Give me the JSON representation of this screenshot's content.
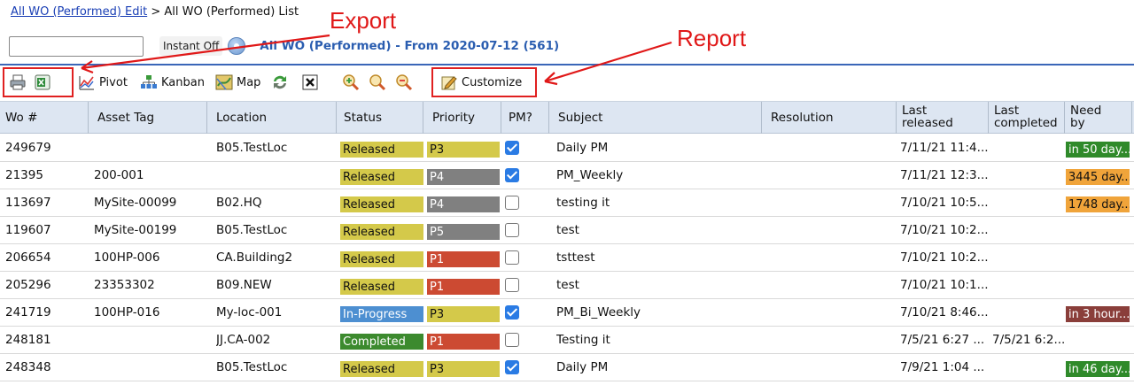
{
  "breadcrumb": {
    "link": "All WO (Performed) Edit",
    "separator": ">",
    "current": "All WO (Performed) List"
  },
  "search": {
    "value": "",
    "placeholder": ""
  },
  "instant_label": "Instant Off",
  "list_title": "All WO (Performed) - From 2020-07-12 (561)",
  "toolbar": {
    "pivot": "Pivot",
    "kanban": "Kanban",
    "map": "Map",
    "customize": "Customize"
  },
  "annotations": {
    "export": "Export",
    "report": "Report"
  },
  "colors": {
    "accent": "#3a66b8",
    "released": "#d4c94a",
    "in_progress": "#4d8fd1",
    "completed": "#3c8a2e",
    "p1": "#cc4a32",
    "p3": "#d4c94a",
    "p4": "#808080",
    "p5": "#808080",
    "need_green": "#2f8a2a",
    "need_orange": "#f0a43a",
    "need_brown": "#8a3e3a",
    "annotation": "#e01818"
  },
  "columns": {
    "wo": "Wo #",
    "asset": "Asset Tag",
    "location": "Location",
    "status": "Status",
    "priority": "Priority",
    "pm": "PM?",
    "subject": "Subject",
    "resolution": "Resolution",
    "last_released_1": "Last",
    "last_released_2": "released",
    "last_completed_1": "Last",
    "last_completed_2": "completed",
    "need_by_1": "Need",
    "need_by_2": "by"
  },
  "rows": [
    {
      "wo": "249679",
      "asset": "",
      "location": "B05.TestLoc",
      "status": "Released",
      "priority": "P3",
      "pm": true,
      "subject": "Daily PM",
      "resolution": "",
      "last_released": "7/11/21 11:4...",
      "last_completed": "",
      "need_by": "in 50 day...",
      "need_color": "green"
    },
    {
      "wo": "21395",
      "asset": "200-001",
      "location": "",
      "status": "Released",
      "priority": "P4",
      "pm": true,
      "subject": "PM_Weekly",
      "resolution": "",
      "last_released": "7/11/21 12:3...",
      "last_completed": "",
      "need_by": "3445 day...",
      "need_color": "orange"
    },
    {
      "wo": "113697",
      "asset": "MySite-00099",
      "location": "B02.HQ",
      "status": "Released",
      "priority": "P4",
      "pm": false,
      "subject": "testing it",
      "resolution": "",
      "last_released": "7/10/21 10:5...",
      "last_completed": "",
      "need_by": "1748 day...",
      "need_color": "orange"
    },
    {
      "wo": "119607",
      "asset": "MySite-00199",
      "location": "B05.TestLoc",
      "status": "Released",
      "priority": "P5",
      "pm": false,
      "subject": "test",
      "resolution": "",
      "last_released": "7/10/21 10:2...",
      "last_completed": "",
      "need_by": "",
      "need_color": ""
    },
    {
      "wo": "206654",
      "asset": "100HP-006",
      "location": "CA.Building2",
      "status": "Released",
      "priority": "P1",
      "pm": false,
      "subject": "tsttest",
      "resolution": "",
      "last_released": "7/10/21 10:2...",
      "last_completed": "",
      "need_by": "",
      "need_color": ""
    },
    {
      "wo": "205296",
      "asset": "23353302",
      "location": "B09.NEW",
      "status": "Released",
      "priority": "P1",
      "pm": false,
      "subject": "test",
      "resolution": "",
      "last_released": "7/10/21 10:1...",
      "last_completed": "",
      "need_by": "",
      "need_color": ""
    },
    {
      "wo": "241719",
      "asset": "100HP-016",
      "location": "My-loc-001",
      "status": "In-Progress",
      "priority": "P3",
      "pm": true,
      "subject": "PM_Bi_Weekly",
      "resolution": "",
      "last_released": "7/10/21 8:46...",
      "last_completed": "",
      "need_by": "in 3 hour...",
      "need_color": "brown"
    },
    {
      "wo": "248181",
      "asset": "",
      "location": "JJ.CA-002",
      "status": "Completed",
      "priority": "P1",
      "pm": false,
      "subject": "Testing it",
      "resolution": "",
      "last_released": "7/5/21 6:27 ...",
      "last_completed": "7/5/21 6:2...",
      "need_by": "",
      "need_color": ""
    },
    {
      "wo": "248348",
      "asset": "",
      "location": "B05.TestLoc",
      "status": "Released",
      "priority": "P3",
      "pm": true,
      "subject": "Daily PM",
      "resolution": "",
      "last_released": "7/9/21 1:04 ...",
      "last_completed": "",
      "need_by": "in 46 day...",
      "need_color": "green"
    }
  ]
}
